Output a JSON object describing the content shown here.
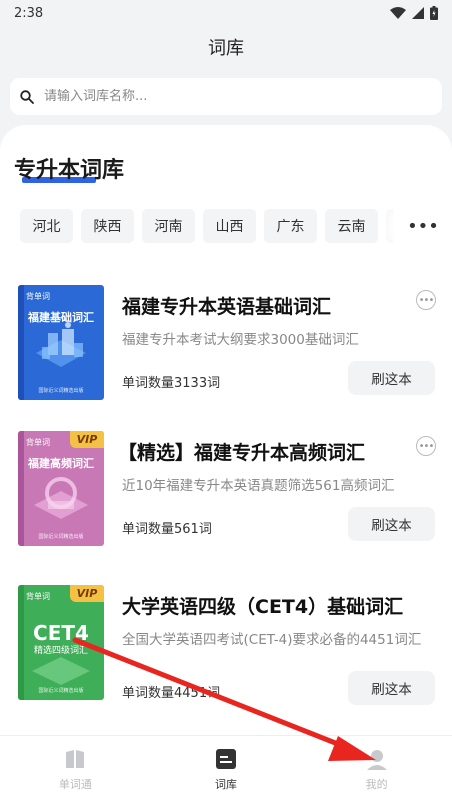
{
  "status_bar": {
    "time": "2:38"
  },
  "header": {
    "title": "词库"
  },
  "search": {
    "placeholder": "请输入词库名称..."
  },
  "section": {
    "title": "专升本词库"
  },
  "regions": [
    "河北",
    "陕西",
    "河南",
    "山西",
    "广东",
    "云南"
  ],
  "more_regions_label": "•••",
  "books": [
    {
      "title": "福建专升本英语基础词汇",
      "description": "福建专升本考试大纲要求3000基础词汇",
      "count": "单词数量3133词",
      "button": "刷这本",
      "cover": {
        "logo": "背单词",
        "label": "福建基础词汇",
        "vip": "",
        "footer": "国际近义词精选出版",
        "color_top": "#3c86e8",
        "color_bottom": "#1f4fb8"
      }
    },
    {
      "title": "【精选】福建专升本高频词汇",
      "description": "近10年福建专升本英语真题筛选561高频词汇",
      "count": "单词数量561词",
      "button": "刷这本",
      "cover": {
        "logo": "背单词",
        "label": "福建高频词汇",
        "vip": "VIP",
        "footer": "国际近义词精选出版",
        "color_top": "#d58bc4",
        "color_bottom": "#a9559a"
      }
    },
    {
      "title": "大学英语四级（CET4）基础词汇",
      "description": "全国大学英语四考试(CET-4)要求必备的4451词汇",
      "count": "单词数量4451词",
      "button": "刷这本",
      "cover": {
        "logo": "背单词",
        "label": "精选四级词汇",
        "big": "CET4",
        "vip": "VIP",
        "footer": "国际近义词精选出版",
        "color_top": "#5cc36c",
        "color_bottom": "#2e9a46"
      }
    }
  ],
  "tabs": [
    {
      "label": "单词通",
      "icon": "book-icon",
      "active": false
    },
    {
      "label": "词库",
      "icon": "library-icon",
      "active": true
    },
    {
      "label": "我的",
      "icon": "profile-icon",
      "active": false
    }
  ],
  "colors": {
    "accent": "#2f63e6",
    "arrow": "#e8261f"
  }
}
